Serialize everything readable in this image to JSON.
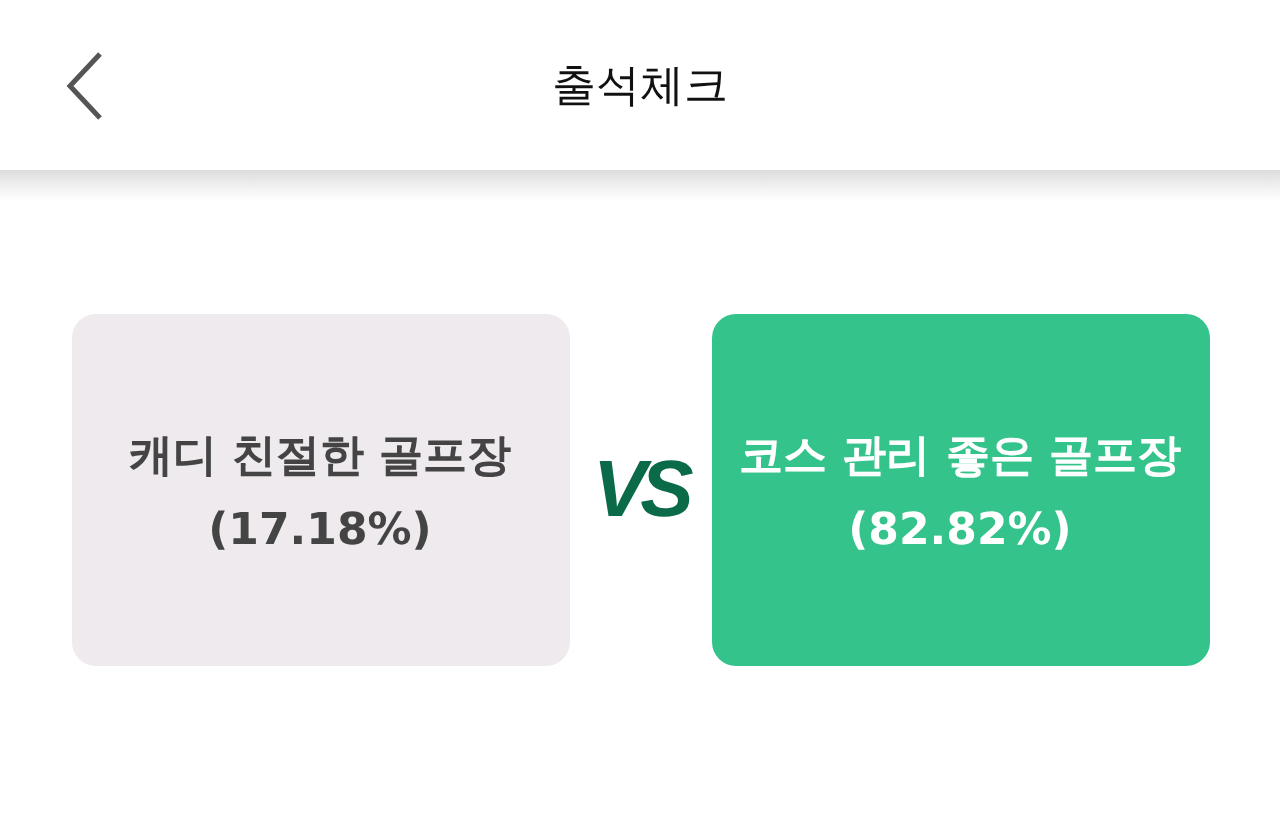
{
  "header": {
    "title": "출석체크"
  },
  "options": [
    {
      "label": "캐디 친절한 골프장",
      "percent": "(17.18%)",
      "selected": false
    },
    {
      "label": "코스 관리 좋은 골프장",
      "percent": "(82.82%)",
      "selected": true
    }
  ],
  "vs_label": "VS"
}
